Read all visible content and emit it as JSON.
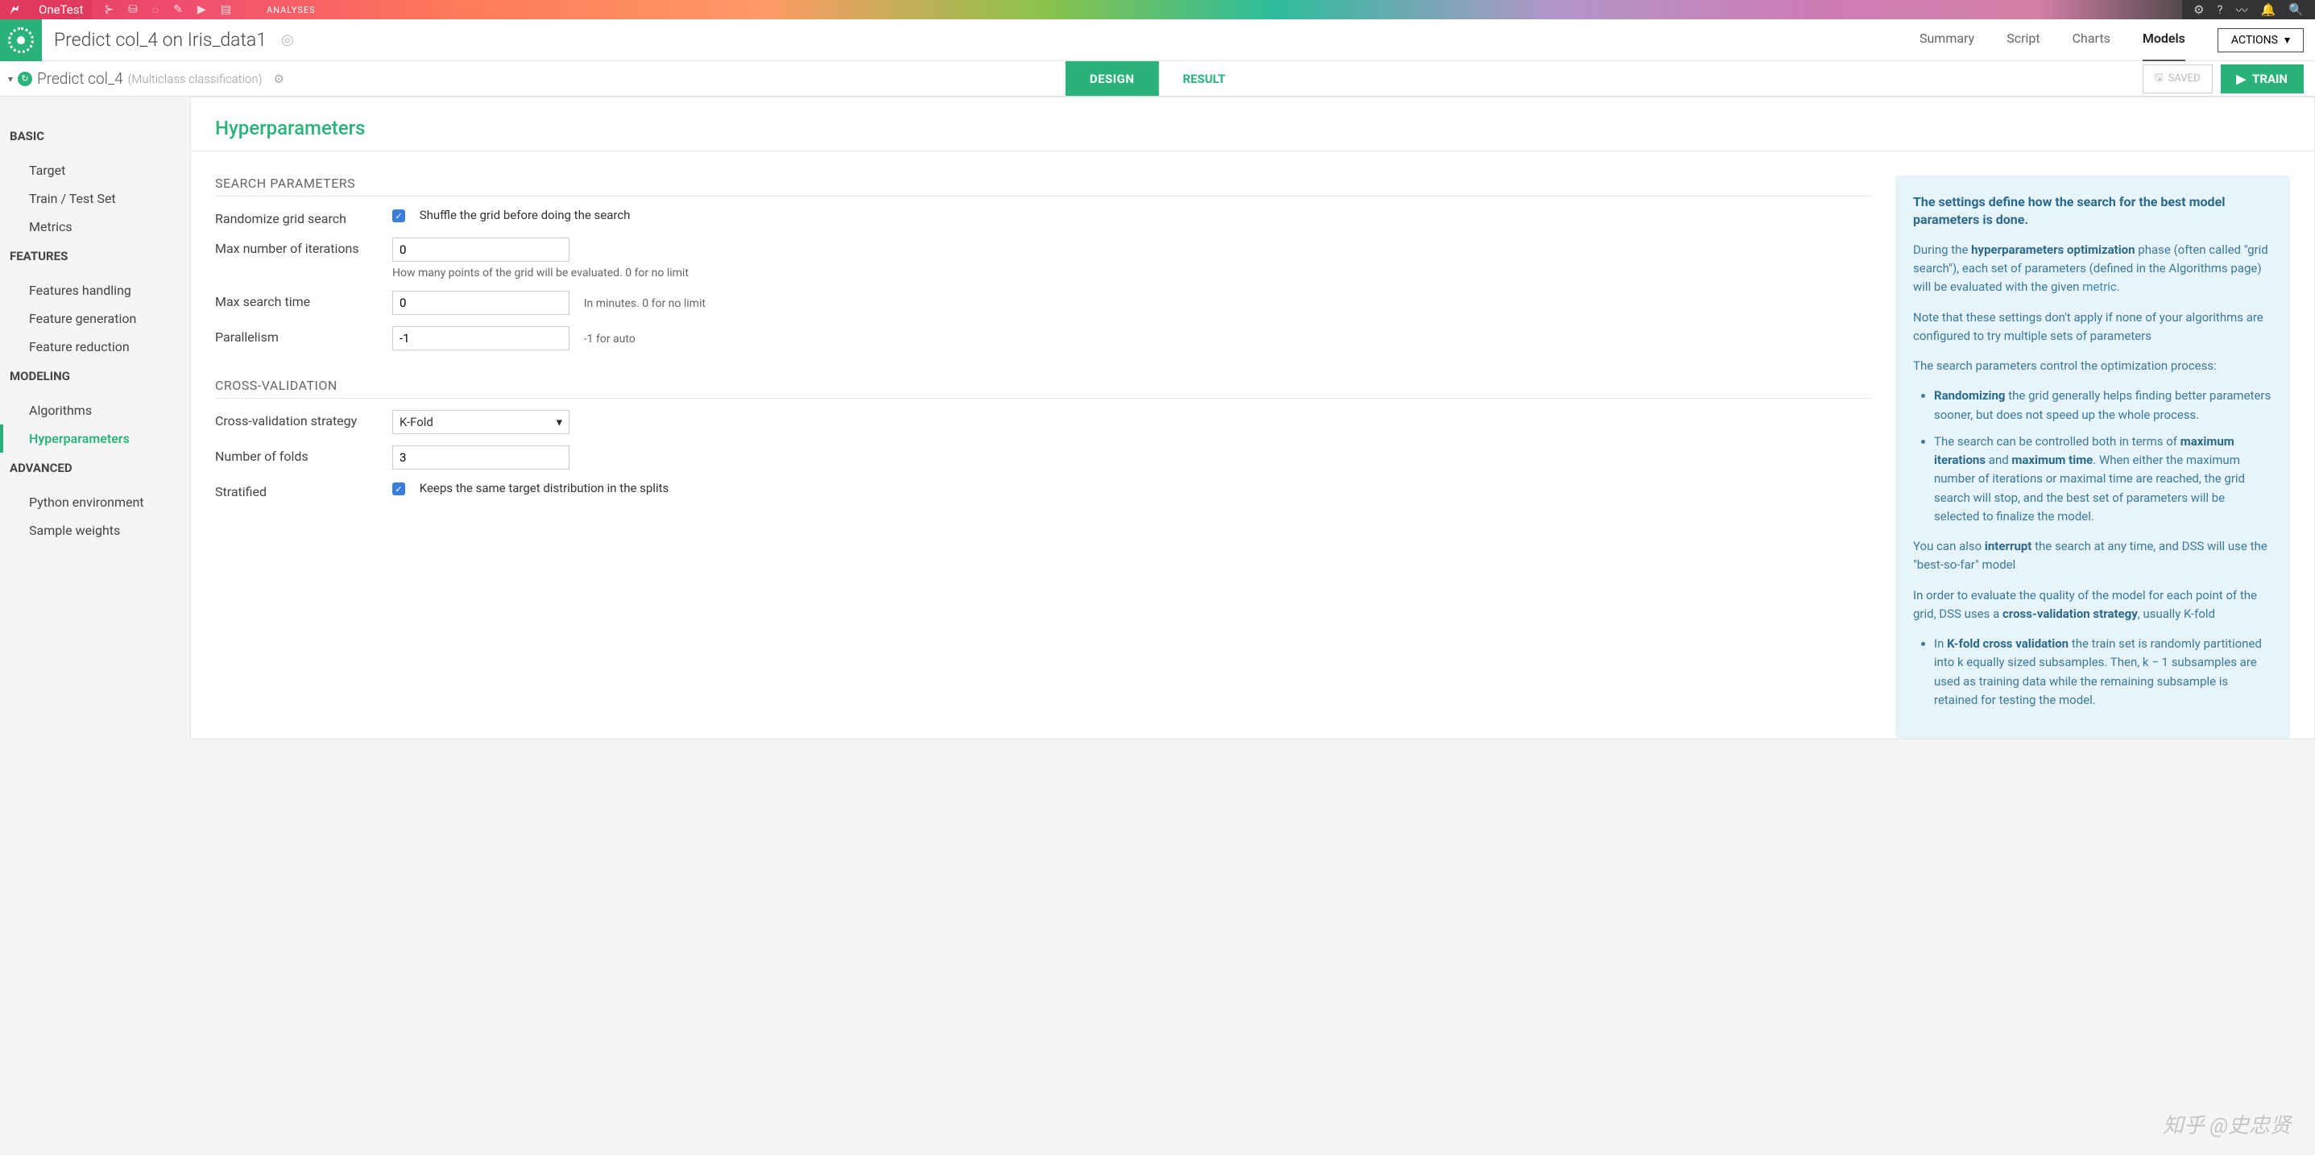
{
  "topbar": {
    "project_name": "OneTest",
    "analyses_label": "ANALYSES"
  },
  "header": {
    "title": "Predict col_4 on Iris_data1",
    "tabs": {
      "summary": "Summary",
      "script": "Script",
      "charts": "Charts",
      "models": "Models"
    },
    "actions_label": "ACTIONS"
  },
  "subheader": {
    "breadcrumb_title": "Predict col_4",
    "breadcrumb_sub": "(Multiclass classification)",
    "design_label": "DESIGN",
    "result_label": "RESULT",
    "saved_label": "SAVED",
    "train_label": "TRAIN"
  },
  "sidebar": {
    "basic": "BASIC",
    "target": "Target",
    "train_test": "Train / Test Set",
    "metrics": "Metrics",
    "features": "FEATURES",
    "features_handling": "Features handling",
    "feature_generation": "Feature generation",
    "feature_reduction": "Feature reduction",
    "modeling": "MODELING",
    "algorithms": "Algorithms",
    "hyperparameters": "Hyperparameters",
    "advanced": "ADVANCED",
    "python_env": "Python environment",
    "sample_weights": "Sample weights"
  },
  "content": {
    "title": "Hyperparameters",
    "search_parameters_header": "SEARCH PARAMETERS",
    "randomize_label": "Randomize grid search",
    "randomize_hint": "Shuffle the grid before doing the search",
    "max_iter_label": "Max number of iterations",
    "max_iter_value": "0",
    "max_iter_hint": "How many points of the grid will be evaluated. 0 for no limit",
    "max_time_label": "Max search time",
    "max_time_value": "0",
    "max_time_hint": "In minutes. 0 for no limit",
    "parallelism_label": "Parallelism",
    "parallelism_value": "-1",
    "parallelism_hint": "-1 for auto",
    "cv_header": "CROSS-VALIDATION",
    "cv_strategy_label": "Cross-validation strategy",
    "cv_strategy_value": "K-Fold",
    "folds_label": "Number of folds",
    "folds_value": "3",
    "stratified_label": "Stratified",
    "stratified_hint": "Keeps the same target distribution in the splits"
  },
  "info": {
    "title": "The settings define how the search for the best model parameters is done.",
    "p1a": "During the ",
    "p1b": "hyperparameters optimization",
    "p1c": " phase (often called \"grid search\"), each set of parameters (defined in the Algorithms page) will be evaluated with the given ",
    "p1d": "metric",
    "p1e": ".",
    "p2": "Note that these settings don't apply if none of your algorithms are configured to try multiple sets of parameters",
    "p3": "The search parameters control the optimization process:",
    "li1a": "Randomizing",
    "li1b": " the grid generally helps finding better parameters sooner, but does not speed up the whole process.",
    "li2a": "The search can be controlled both in terms of ",
    "li2b": "maximum iterations",
    "li2c": " and ",
    "li2d": "maximum time",
    "li2e": ". When either the maximum number of iterations or maximal time are reached, the grid search will stop, and the best set of parameters will be selected to finalize the model.",
    "p4a": "You can also ",
    "p4b": "interrupt",
    "p4c": " the search at any time, and DSS will use the \"best-so-far\" model",
    "p5a": "In order to evaluate the quality of the model for each point of the grid, DSS uses a ",
    "p5b": "cross-validation strategy",
    "p5c": ", usually K-fold",
    "li3a": "In ",
    "li3b": "K-fold cross validation",
    "li3c": " the train set is randomly partitioned into k equally sized subsamples. Then, k − 1 subsamples are used as training data while the remaining subsample is retained for testing the model."
  },
  "watermark": "知乎 @史忠贤"
}
